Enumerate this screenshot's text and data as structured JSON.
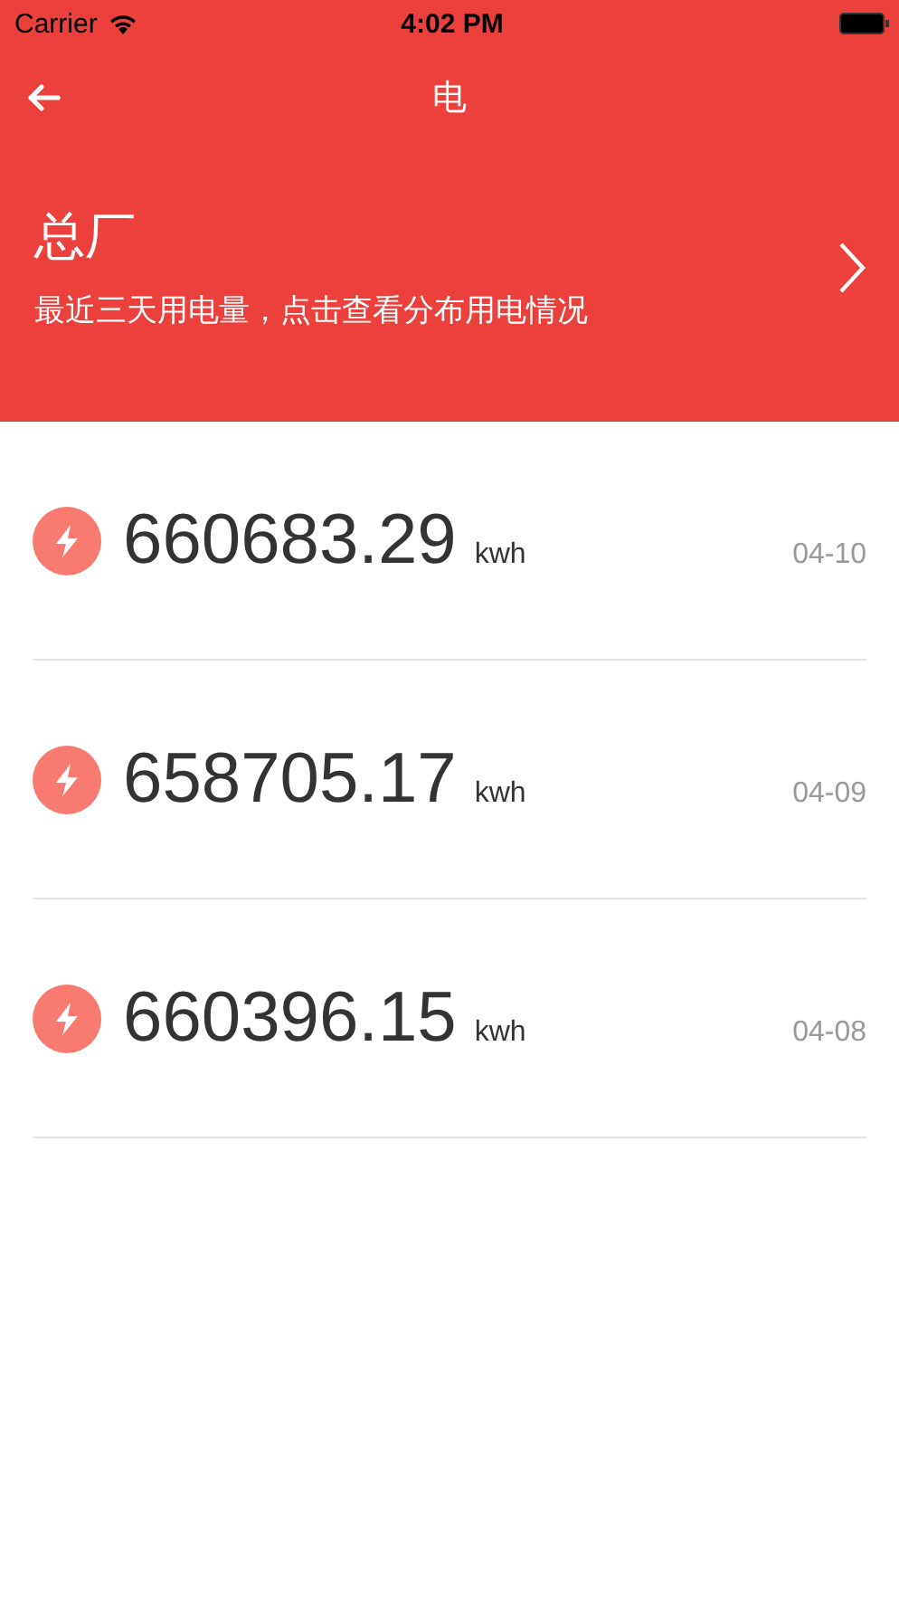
{
  "status_bar": {
    "carrier": "Carrier",
    "time": "4:02 PM"
  },
  "nav": {
    "title": "电"
  },
  "header": {
    "title": "总厂",
    "subtitle": "最近三天用电量，点击查看分布用电情况"
  },
  "readings": [
    {
      "value": "660683.29",
      "unit": "kwh",
      "date": "04-10"
    },
    {
      "value": "658705.17",
      "unit": "kwh",
      "date": "04-09"
    },
    {
      "value": "660396.15",
      "unit": "kwh",
      "date": "04-08"
    }
  ]
}
